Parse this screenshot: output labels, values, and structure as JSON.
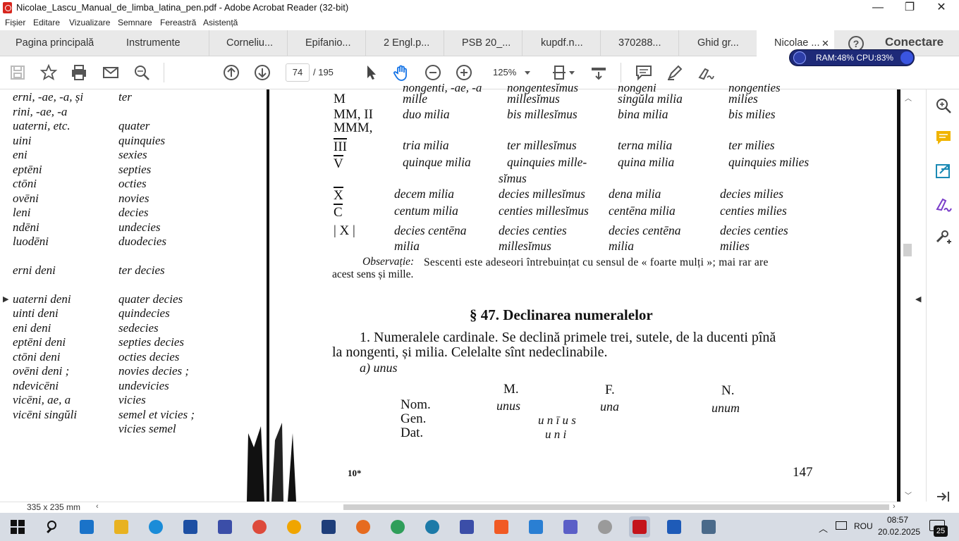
{
  "window": {
    "title": "Nicolae_Lascu_Manual_de_limba_latina_pen.pdf - Adobe Acrobat Reader (32-bit)",
    "minimize": "—",
    "maximize": "❐",
    "close": "✕"
  },
  "menu": [
    "Fișier",
    "Editare",
    "Vizualizare",
    "Semnare",
    "Fereastră",
    "Asistență"
  ],
  "tabs": {
    "home": "Pagina principală",
    "tools": "Instrumente",
    "docs": [
      "Corneliu...",
      "Epifanio...",
      "2 Engl.p...",
      "PSB 20_...",
      "kupdf.n...",
      "370288...",
      "Ghid gr...",
      "Nicolae ..."
    ],
    "active_close": "✕",
    "help": "?",
    "connect": "Conectare"
  },
  "toolbar": {
    "page_current": "74",
    "page_total": "/  195",
    "zoom": "125%"
  },
  "perf": {
    "text": "RAM:48%  CPU:83%"
  },
  "status": {
    "doc_size": "335 x 235 mm"
  },
  "page_left": {
    "col1": [
      "erni, -ae, -a, și",
      "rini, -ae, -a",
      "uaterni, etc.",
      "uini",
      "eni",
      "eptēni",
      "ctōni",
      "ovēni",
      "leni",
      "ndēni",
      "luodēni",
      "erni deni",
      "uaterni deni",
      "uinti deni",
      "eni deni",
      "eptēni deni",
      "ctōni deni",
      "ovēni deni ;",
      "ndevicēni",
      "vicēni, ae, a",
      "vicēni singŭli"
    ],
    "col2": [
      "ter",
      "",
      "quater",
      "quinquies",
      "sexies",
      "septies",
      "octies",
      "novies",
      "decies",
      "undecies",
      "duodecies",
      "ter decies",
      "quater decies",
      "quindecies",
      "sedecies",
      "septies decies",
      "octies decies",
      "novies decies ;",
      "undevicies",
      "vicies",
      "semel et vicies ;",
      "vicies semel"
    ]
  },
  "page_right": {
    "top_partial": [
      "nongenti, -ae, -a",
      "nongentesĭmus",
      "nongeni",
      "nongenties"
    ],
    "rows": [
      {
        "num": "M",
        "c1": "mille",
        "c2": "millesĭmus",
        "c3": "singŭla milia",
        "c4": "milies"
      },
      {
        "num": "MM, II",
        "c1": "duo milia",
        "c2": "bis millesĭmus",
        "c3": "bina milia",
        "c4": "bis milies"
      },
      {
        "num": "MMM,",
        "c1": "",
        "c2": "",
        "c3": "",
        "c4": ""
      },
      {
        "num": "III",
        "c1": "tria milia",
        "c2": "ter millesĭmus",
        "c3": "terna milia",
        "c4": "ter milies"
      },
      {
        "num": "V",
        "c1": "quinque milia",
        "c2": "quinquies mille-",
        "c3": "quina milia",
        "c4": "quinquies milies"
      },
      {
        "num": "",
        "c1": "",
        "c2": "sĭmus",
        "c3": "",
        "c4": ""
      },
      {
        "num": "X",
        "c1": "decem milia",
        "c2": "decies millesĭmus",
        "c3": "dena milia",
        "c4": "decies milies"
      },
      {
        "num": "C",
        "c1": "centum milia",
        "c2": "centies millesĭmus",
        "c3": "centēna milia",
        "c4": "centies milies"
      },
      {
        "num": "| X |",
        "c1": "decies centēna",
        "c2": "decies centies",
        "c3": "decies centēna",
        "c4": "decies centies"
      },
      {
        "num": "",
        "c1": "milia",
        "c2": "millesĭmus",
        "c3": "milia",
        "c4": "milies"
      }
    ],
    "obs_line1_label": "Observație:",
    "obs_line1_rest": "Sescenti este adeseori întrebuințat cu sensul de « foarte mulți »; mai rar are",
    "obs_line2": "acest  sens  și  mille.",
    "section_title": "§ 47.  Declinarea numeralelor",
    "para_line1": "1. Numeralele cardinale. Se declină primele trei, sutele, de la ducenti  pînă",
    "para_line2": "la nongenti, și milia. Celelalte sînt nedeclinabile.",
    "sub_a": "a)  unus",
    "decl_headers": [
      "M.",
      "F.",
      "N."
    ],
    "decl_rows": [
      {
        "case": "Nom.",
        "m": "unus",
        "f": "una",
        "n": "unum",
        "all": ""
      },
      {
        "case": "Gen.",
        "m": "",
        "f": "",
        "n": "",
        "all": "u n ī u s"
      },
      {
        "case": "Dat.",
        "m": "",
        "f": "",
        "n": "",
        "all": "u n i"
      }
    ],
    "footer_left": "10*",
    "page_number": "147"
  },
  "taskbar": {
    "lang": "ROU",
    "time": "08:57",
    "date": "20.02.2025",
    "notif_count": "25",
    "icons": [
      "start-icon",
      "search-icon",
      "ie-icon",
      "file-explorer-icon",
      "edge-icon",
      "media-icon",
      "save-app-icon",
      "chrome-icon",
      "app-orange-icon",
      "app-blue-icon",
      "firefox-icon",
      "globe-icon",
      "calc-icon",
      "save-app2-icon",
      "brave-icon",
      "app-shield-icon",
      "app-cube-icon",
      "app-bw-icon",
      "acrobat-icon",
      "word-icon",
      "app-screen-icon"
    ]
  }
}
